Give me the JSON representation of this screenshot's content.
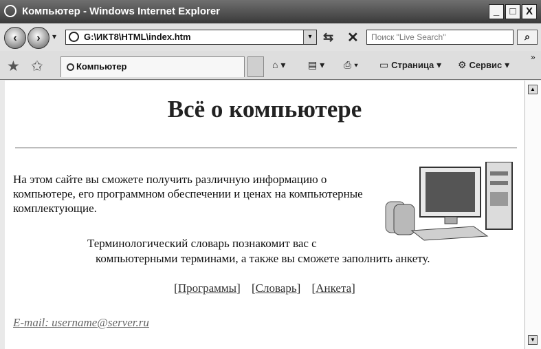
{
  "window": {
    "title": "Компьютер - Windows Internet Explorer",
    "controls": {
      "minimize": "_",
      "maximize": "□",
      "close": "X"
    }
  },
  "navbar": {
    "address": "G:\\ИКТ8\\HTML\\index.htm",
    "search_placeholder": "Поиск \"Live Search\"",
    "search_button": "⌕"
  },
  "commandbar": {
    "tab_label": "Компьютер",
    "page_menu": "Страница",
    "tools_menu": "Сервис"
  },
  "page": {
    "heading": "Всё о компьютере",
    "intro": "На этом сайте вы сможете получить различную информацию о компьютере, его программном обеспечении и ценах на компьютерные комплектующие.",
    "para2_line1": "Терминологический словарь познакомит вас с",
    "para2_line2": "компьютерными терминами, а также вы сможете заполнить анкету.",
    "links": [
      "Программы",
      "Словарь",
      "Анкета"
    ],
    "email": "E-mail: username@server.ru"
  },
  "icons": {
    "back": "back-arrow-icon",
    "forward": "forward-arrow-icon",
    "refresh": "refresh-icon",
    "stop": "stop-icon",
    "favorites": "star-icon",
    "home": "home-icon",
    "feeds": "rss-icon",
    "print": "printer-icon",
    "page": "page-icon",
    "tools": "gear-icon"
  },
  "colors": {
    "titlebar": "#3a3a3a",
    "page_background": "#ffffff",
    "link": "#333333"
  }
}
